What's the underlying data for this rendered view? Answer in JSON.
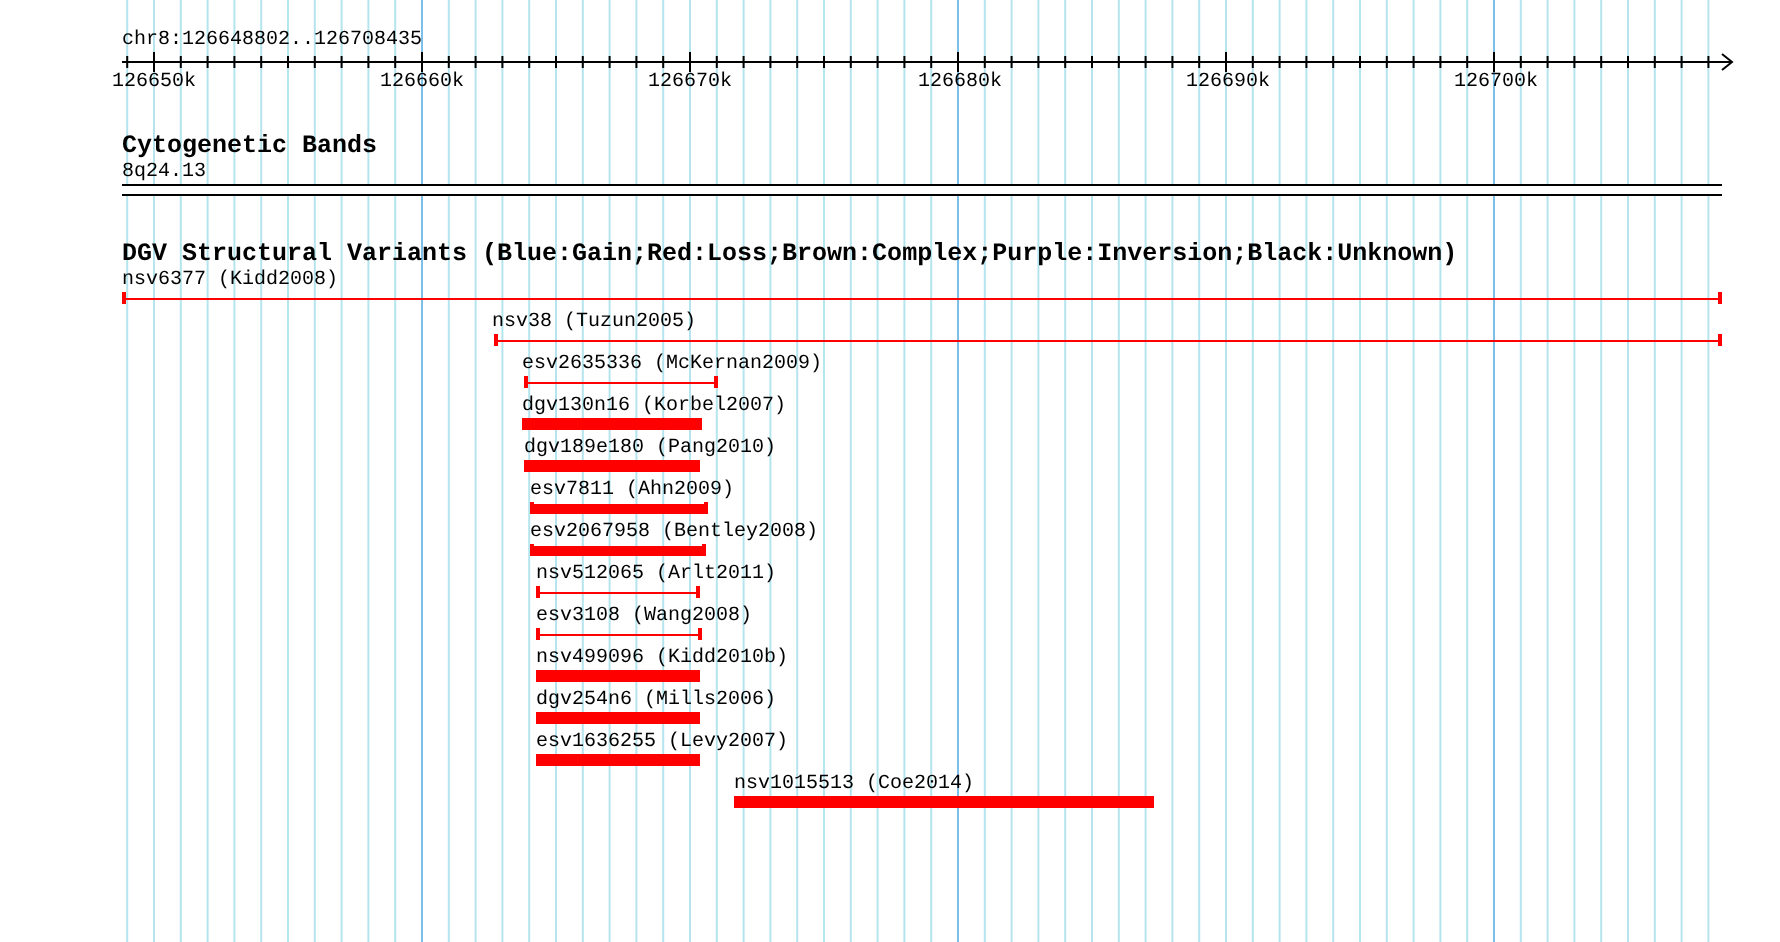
{
  "ruler": {
    "location": "chr8:126648802..126708435",
    "ticks": [
      "126650k",
      "126660k",
      "126670k",
      "126680k",
      "126690k",
      "126700k"
    ]
  },
  "tracks": [
    {
      "title": "Cytogenetic Bands",
      "features": [
        {
          "label": "8q24.13",
          "kind": "band"
        }
      ]
    },
    {
      "title": "DGV Structural Variants (Blue:Gain;Red:Loss;Brown:Complex;Purple:Inversion;Black:Unknown)",
      "features": [
        {
          "label": "nsv6377 (Kidd2008)",
          "kind": "line"
        },
        {
          "label": "nsv38 (Tuzun2005)",
          "kind": "line"
        },
        {
          "label": "esv2635336 (McKernan2009)",
          "kind": "line"
        },
        {
          "label": "dgv130n16 (Korbel2007)",
          "kind": "bar"
        },
        {
          "label": "dgv189e180 (Pang2010)",
          "kind": "bar"
        },
        {
          "label": "esv7811 (Ahn2009)",
          "kind": "capped_bar"
        },
        {
          "label": "esv2067958 (Bentley2008)",
          "kind": "capped_bar"
        },
        {
          "label": "nsv512065 (Arlt2011)",
          "kind": "line"
        },
        {
          "label": "esv3108 (Wang2008)",
          "kind": "line"
        },
        {
          "label": "nsv499096 (Kidd2010b)",
          "kind": "bar"
        },
        {
          "label": "dgv254n6 (Mills2006)",
          "kind": "bar"
        },
        {
          "label": "esv1636255 (Levy2007)",
          "kind": "bar"
        },
        {
          "label": "nsv1015513 (Coe2014)",
          "kind": "bar"
        }
      ]
    }
  ]
}
